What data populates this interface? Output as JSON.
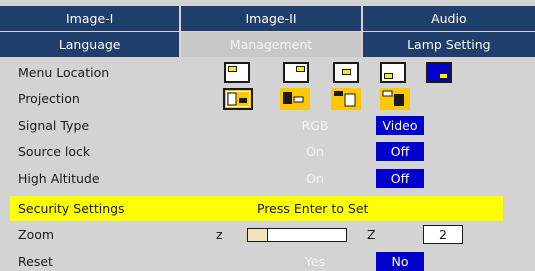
{
  "tabs_row1": [
    {
      "label": "Image-I"
    },
    {
      "label": "Image-II"
    },
    {
      "label": "Audio"
    }
  ],
  "tabs_row2": [
    {
      "label": "Language"
    },
    {
      "label": "Management",
      "active": true
    },
    {
      "label": "Lamp Setting"
    }
  ],
  "menu": {
    "menu_location": {
      "label": "Menu Location",
      "icons": [
        "top-left-icon",
        "top-right-icon",
        "center-icon",
        "bottom-left-icon",
        "bottom-right-icon"
      ],
      "selected": 4
    },
    "projection": {
      "label": "Projection",
      "icons": [
        "front-desktop-icon",
        "rear-desktop-icon",
        "front-ceiling-icon",
        "rear-ceiling-icon"
      ],
      "selected": 0
    },
    "signal_type": {
      "label": "Signal Type",
      "options": [
        "RGB",
        "Video"
      ],
      "selected": 1
    },
    "source_lock": {
      "label": "Source lock",
      "options": [
        "On",
        "Off"
      ],
      "selected": 1
    },
    "high_altitude": {
      "label": "High Altitude",
      "options": [
        "On",
        "Off"
      ],
      "selected": 1
    },
    "security_settings": {
      "label": "Security Settings",
      "message": "Press Enter to Set"
    },
    "zoom": {
      "label": "Zoom",
      "min_label": "z",
      "max_label": "Z",
      "value": "2",
      "level": 0.2
    },
    "reset": {
      "label": "Reset",
      "options": [
        "Yes",
        "No"
      ],
      "selected": 1
    }
  },
  "colors": {
    "tab_bg": "#1f3e6b",
    "panel_bg": "#d3d3d3",
    "selected_bg": "#0000cc",
    "highlight_bg": "#ffff00"
  }
}
